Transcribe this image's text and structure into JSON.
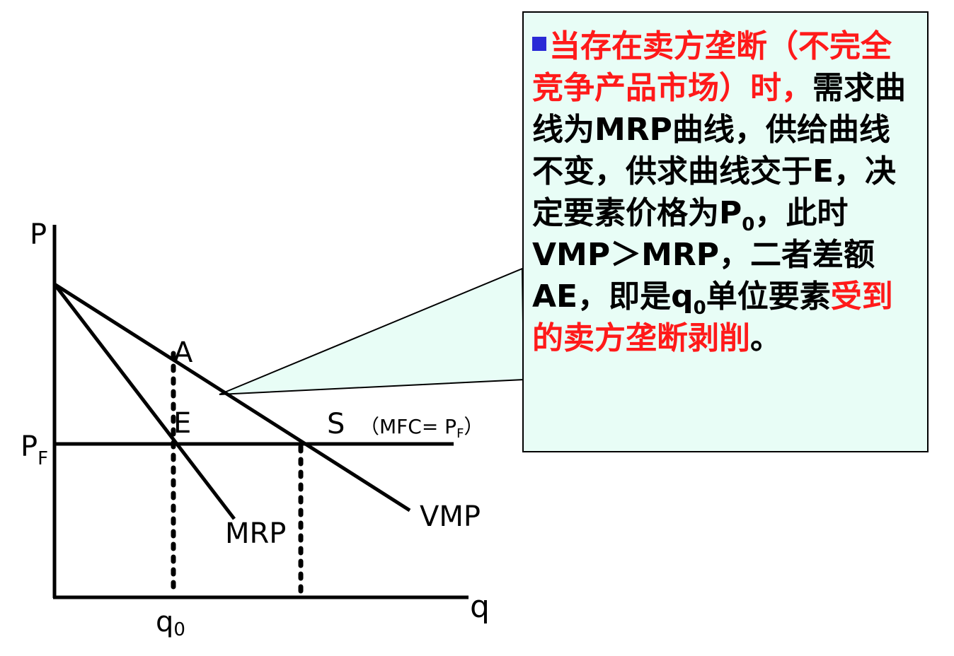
{
  "graph": {
    "axis_y_label": "P",
    "axis_x_label": "q",
    "pf_label": "P",
    "pf_sub": "F",
    "q0_label": "q",
    "q0_sub": "0",
    "point_a": "A",
    "point_e": "E",
    "supply_label": "S",
    "supply_note_pre": "（MFC= P",
    "supply_note_sub": "F",
    "supply_note_post": "）",
    "mrp_label": "MRP",
    "vmp_label": "VMP"
  },
  "callout": {
    "red_1": "当存在卖方垄断（不完全竞争产品市场）时，",
    "black_1": "需求曲线为MRP曲线，供给曲线不变，供求曲线交于E，决定要素价格为P",
    "p_sub": "0",
    "black_2": "，此时VMP＞MRP，二者差额AE，即是q",
    "q_sub": "0",
    "black_3": "单位要素",
    "red_2": "受到的卖方垄断剥削",
    "end": "。"
  },
  "colors": {
    "callout_bg": "#e8fdf6",
    "highlight_red": "#ff1a1a",
    "bullet_blue": "#2a2ad6"
  }
}
